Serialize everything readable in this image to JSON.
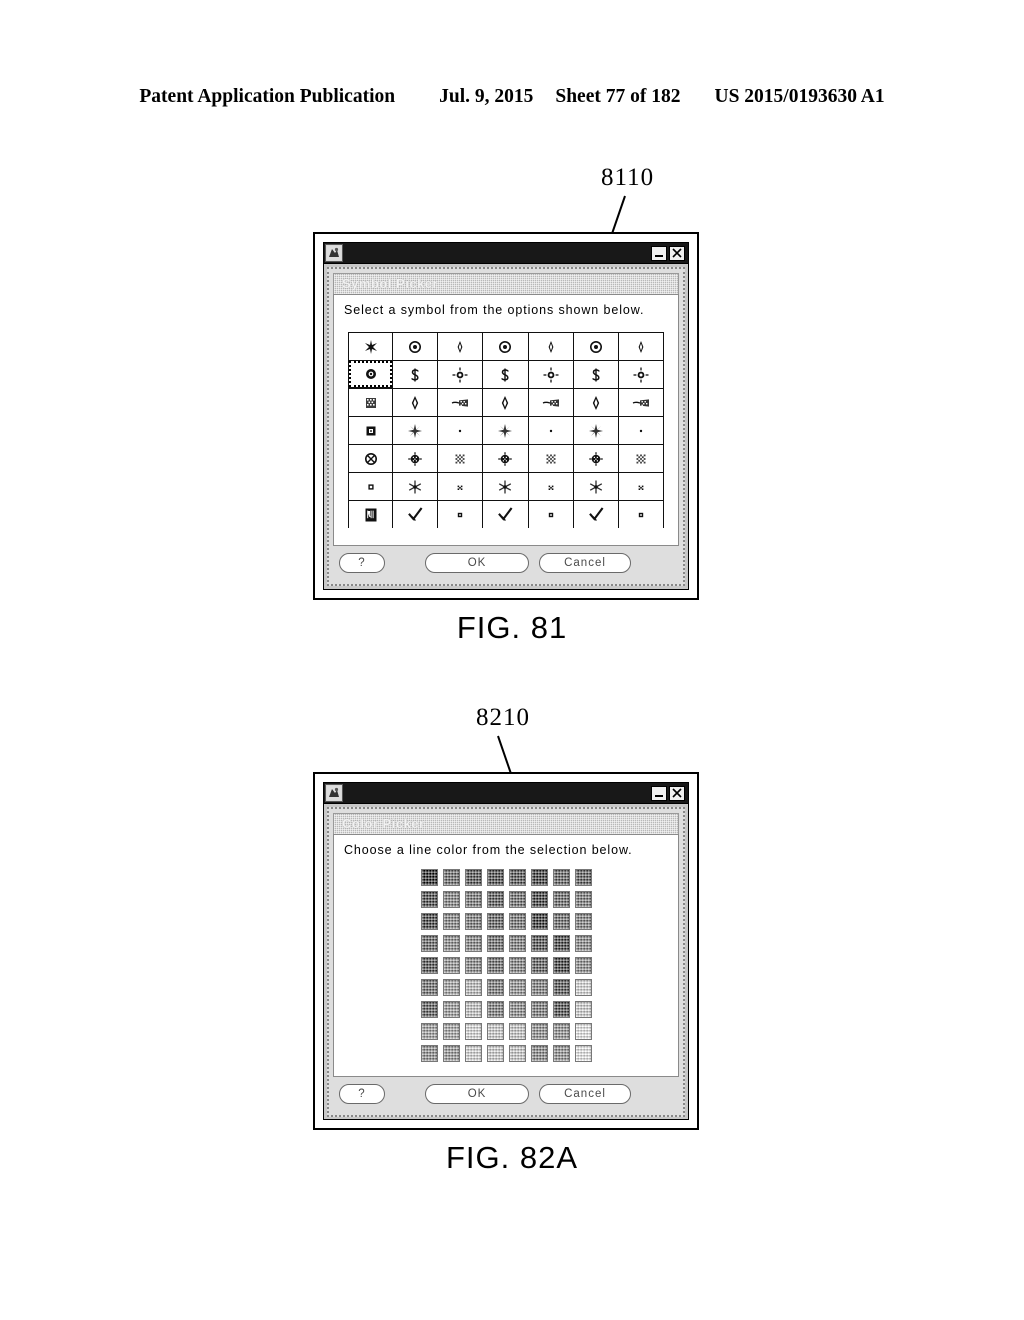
{
  "page_header": {
    "publication": "Patent Application Publication",
    "date": "Jul. 9, 2015",
    "sheet": "Sheet 77 of 182",
    "publication_number": "US 2015/0193630 A1"
  },
  "figures": [
    {
      "caption": "FIG. 81",
      "reference_numeral": "8110",
      "window": {
        "title_bar": {
          "icon": "app-icon",
          "minimize_label": "_",
          "close_label": "X"
        },
        "heading": "Symbol Picker",
        "instruction": "Select a symbol from the options shown below.",
        "grid": {
          "type": "symbol",
          "columns": 7,
          "rows": 7,
          "selected_index": 7,
          "cells": [
            {
              "glyph": "propeller"
            },
            {
              "glyph": "ring-dot"
            },
            {
              "glyph": "small-diamond"
            },
            {
              "glyph": "ring-dot"
            },
            {
              "glyph": "small-diamond"
            },
            {
              "glyph": "ring-dot"
            },
            {
              "glyph": "small-diamond"
            },
            {
              "glyph": "filled-ring-dot"
            },
            {
              "glyph": "dollar"
            },
            {
              "glyph": "burst-dot"
            },
            {
              "glyph": "dollar"
            },
            {
              "glyph": "burst-dot"
            },
            {
              "glyph": "dollar"
            },
            {
              "glyph": "burst-dot"
            },
            {
              "glyph": "checker-block"
            },
            {
              "glyph": "diamond"
            },
            {
              "glyph": "tapered-trail"
            },
            {
              "glyph": "diamond"
            },
            {
              "glyph": "tapered-trail"
            },
            {
              "glyph": "diamond"
            },
            {
              "glyph": "tapered-trail"
            },
            {
              "glyph": "square-in-square"
            },
            {
              "glyph": "star-burst"
            },
            {
              "glyph": "tiny-dot"
            },
            {
              "glyph": "star-burst"
            },
            {
              "glyph": "tiny-dot"
            },
            {
              "glyph": "star-burst"
            },
            {
              "glyph": "tiny-dot"
            },
            {
              "glyph": "ring-cross"
            },
            {
              "glyph": "dense-burst"
            },
            {
              "glyph": "checker-square"
            },
            {
              "glyph": "dense-burst"
            },
            {
              "glyph": "checker-square"
            },
            {
              "glyph": "dense-burst"
            },
            {
              "glyph": "checker-square"
            },
            {
              "glyph": "small-square"
            },
            {
              "glyph": "snowflake"
            },
            {
              "glyph": "micro-cross"
            },
            {
              "glyph": "snowflake"
            },
            {
              "glyph": "micro-cross"
            },
            {
              "glyph": "snowflake"
            },
            {
              "glyph": "micro-cross"
            },
            {
              "glyph": "filled-rect-icon"
            },
            {
              "glyph": "checkmark"
            },
            {
              "glyph": "tiny-square"
            },
            {
              "glyph": "checkmark"
            },
            {
              "glyph": "tiny-square"
            },
            {
              "glyph": "checkmark"
            },
            {
              "glyph": "tiny-square"
            }
          ]
        },
        "buttons": {
          "help": "?",
          "ok": "OK",
          "cancel": "Cancel"
        }
      }
    },
    {
      "caption": "FIG. 82A",
      "reference_numeral": "8210",
      "window": {
        "title_bar": {
          "icon": "app-icon",
          "minimize_label": "_",
          "close_label": "X"
        },
        "heading": "Color Picker",
        "instruction": "Choose a line color from the selection below.",
        "grid": {
          "type": "color",
          "columns": 8,
          "rows": 9,
          "swatches": [
            "#000000",
            "#5a5a5a",
            "#3a3a3a",
            "#303030",
            "#3c3c3c",
            "#1c1c1c",
            "#4c4c4c",
            "#484848",
            "#2e2e2e",
            "#7a7a7a",
            "#6a6a6a",
            "#444444",
            "#5e5e5e",
            "#1e1e1e",
            "#585858",
            "#6e6e6e",
            "#262626",
            "#7e7e7e",
            "#707070",
            "#4e4e4e",
            "#666666",
            "#141414",
            "#5c5c5c",
            "#747474",
            "#545454",
            "#868686",
            "#7c7c7c",
            "#5a5a5a",
            "#727272",
            "#383838",
            "#2a2a2a",
            "#808080",
            "#3a3a3a",
            "#8c8c8c",
            "#828282",
            "#606060",
            "#7a7a7a",
            "#4a4a4a",
            "#222222",
            "#888888",
            "#626262",
            "#a2a2a2",
            "#c6c6c6",
            "#6e6e6e",
            "#8e8e8e",
            "#767676",
            "#3e3e3e",
            "#eaeaea",
            "#4a4a4a",
            "#9a9a9a",
            "#d0d0d0",
            "#747474",
            "#868686",
            "#707070",
            "#343434",
            "#e0e0e0",
            "#9e9e9e",
            "#a8a8a8",
            "#ececec",
            "#dcdcdc",
            "#d4d4d4",
            "#8a8a8a",
            "#8e8e8e",
            "#ffffff",
            "#8a8a8a",
            "#969696",
            "#e6e6e6",
            "#e0e0e0",
            "#d8d8d8",
            "#808080",
            "#8c8c8c",
            "#ffffff"
          ]
        },
        "buttons": {
          "help": "?",
          "ok": "OK",
          "cancel": "Cancel"
        }
      }
    }
  ]
}
